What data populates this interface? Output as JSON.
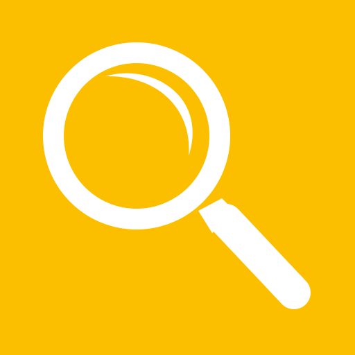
{
  "icon": {
    "name": "magnifying-glass-icon"
  },
  "colors": {
    "background": "#FCBF00",
    "foreground": "#FFFFFF"
  }
}
